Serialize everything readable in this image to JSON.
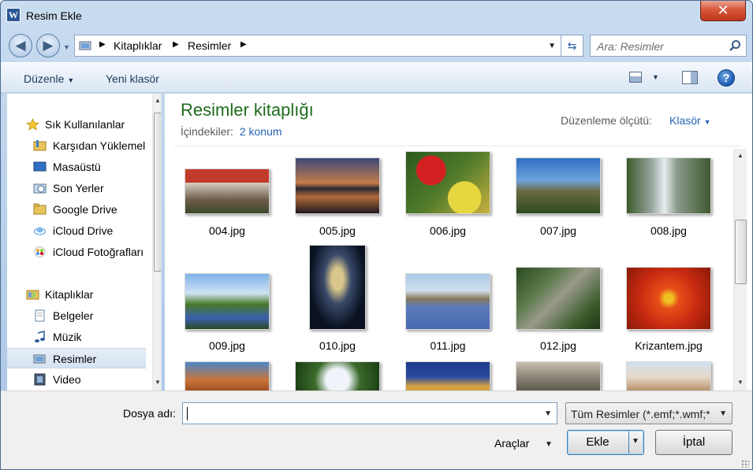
{
  "window": {
    "title": "Resim Ekle",
    "app_icon_letter": "W",
    "close_glyph": "✕"
  },
  "nav": {
    "back_glyph": "◀",
    "forward_glyph": "▶",
    "breadcrumb": [
      "Kitaplıklar",
      "Resimler"
    ],
    "search_placeholder": "Ara: Resimler"
  },
  "toolbar": {
    "organize": "Düzenle",
    "new_folder": "Yeni klasör",
    "help": "?"
  },
  "sidebar": {
    "items": [
      {
        "label": "Sık Kullanılanlar",
        "icon": "star-icon",
        "level": 0
      },
      {
        "label": "Karşıdan Yüklemeler",
        "icon": "downloads-folder-icon",
        "level": 1
      },
      {
        "label": "Masaüstü",
        "icon": "desktop-icon",
        "level": 1
      },
      {
        "label": "Son Yerler",
        "icon": "recent-places-icon",
        "level": 1
      },
      {
        "label": "Google Drive",
        "icon": "google-drive-folder-icon",
        "level": 1
      },
      {
        "label": "iCloud Drive",
        "icon": "icloud-drive-icon",
        "level": 1
      },
      {
        "label": "iCloud Fotoğrafları",
        "icon": "icloud-photos-icon",
        "level": 1
      },
      {
        "label": "Kitaplıklar",
        "icon": "libraries-icon",
        "level": 0
      },
      {
        "label": "Belgeler",
        "icon": "documents-library-icon",
        "level": 1
      },
      {
        "label": "Müzik",
        "icon": "music-library-icon",
        "level": 1
      },
      {
        "label": "Resimler",
        "icon": "pictures-library-icon",
        "level": 1,
        "selected": true
      },
      {
        "label": "Video",
        "icon": "video-library-icon",
        "level": 1
      }
    ]
  },
  "main": {
    "title": "Resimler kitaplığı",
    "subtitle_label": "İçindekiler:",
    "subtitle_link": "2 konum",
    "arrange_label": "Düzenleme ölçütü:",
    "arrange_value": "Klasör",
    "files": [
      {
        "name": "004.jpg"
      },
      {
        "name": "005.jpg"
      },
      {
        "name": "006.jpg"
      },
      {
        "name": "007.jpg"
      },
      {
        "name": "008.jpg"
      },
      {
        "name": "009.jpg"
      },
      {
        "name": "010.jpg"
      },
      {
        "name": "011.jpg"
      },
      {
        "name": "012.jpg"
      },
      {
        "name": "Krizantem.jpg"
      }
    ]
  },
  "footer": {
    "filename_label": "Dosya adı:",
    "filename_value": "",
    "filter_value": "Tüm Resimler (*.emf;*.wmf;*",
    "tools_label": "Araçlar",
    "insert_label": "Ekle",
    "cancel_label": "İptal"
  }
}
